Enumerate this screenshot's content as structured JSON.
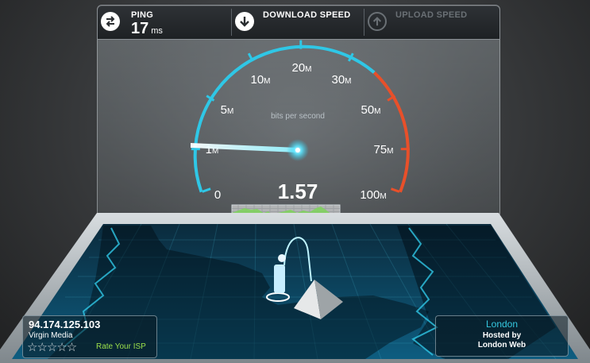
{
  "ping": {
    "label": "PING",
    "value": "17",
    "unit": "ms"
  },
  "download": {
    "label": "DOWNLOAD SPEED"
  },
  "upload": {
    "label": "UPLOAD SPEED"
  },
  "gauge": {
    "caption": "bits per second",
    "reading": "1.57",
    "reading_mbps": 1.57,
    "scale": [
      {
        "n": "0",
        "u": ""
      },
      {
        "n": "1",
        "u": "M"
      },
      {
        "n": "5",
        "u": "M"
      },
      {
        "n": "10",
        "u": "M"
      },
      {
        "n": "20",
        "u": "M"
      },
      {
        "n": "30",
        "u": "M"
      },
      {
        "n": "50",
        "u": "M"
      },
      {
        "n": "75",
        "u": "M"
      },
      {
        "n": "100",
        "u": "M"
      }
    ]
  },
  "client": {
    "ip": "94.174.125.103",
    "isp": "Virgin Media",
    "stars": "☆☆☆☆☆",
    "rate_label": "Rate Your ISP"
  },
  "server": {
    "city": "London",
    "hosted_by": "Hosted by",
    "host": "London Web"
  },
  "colors": {
    "accent": "#2fc7e6",
    "warning": "#e8502a",
    "graph": "#7ed35a",
    "upload_disabled": "#6a7075"
  }
}
